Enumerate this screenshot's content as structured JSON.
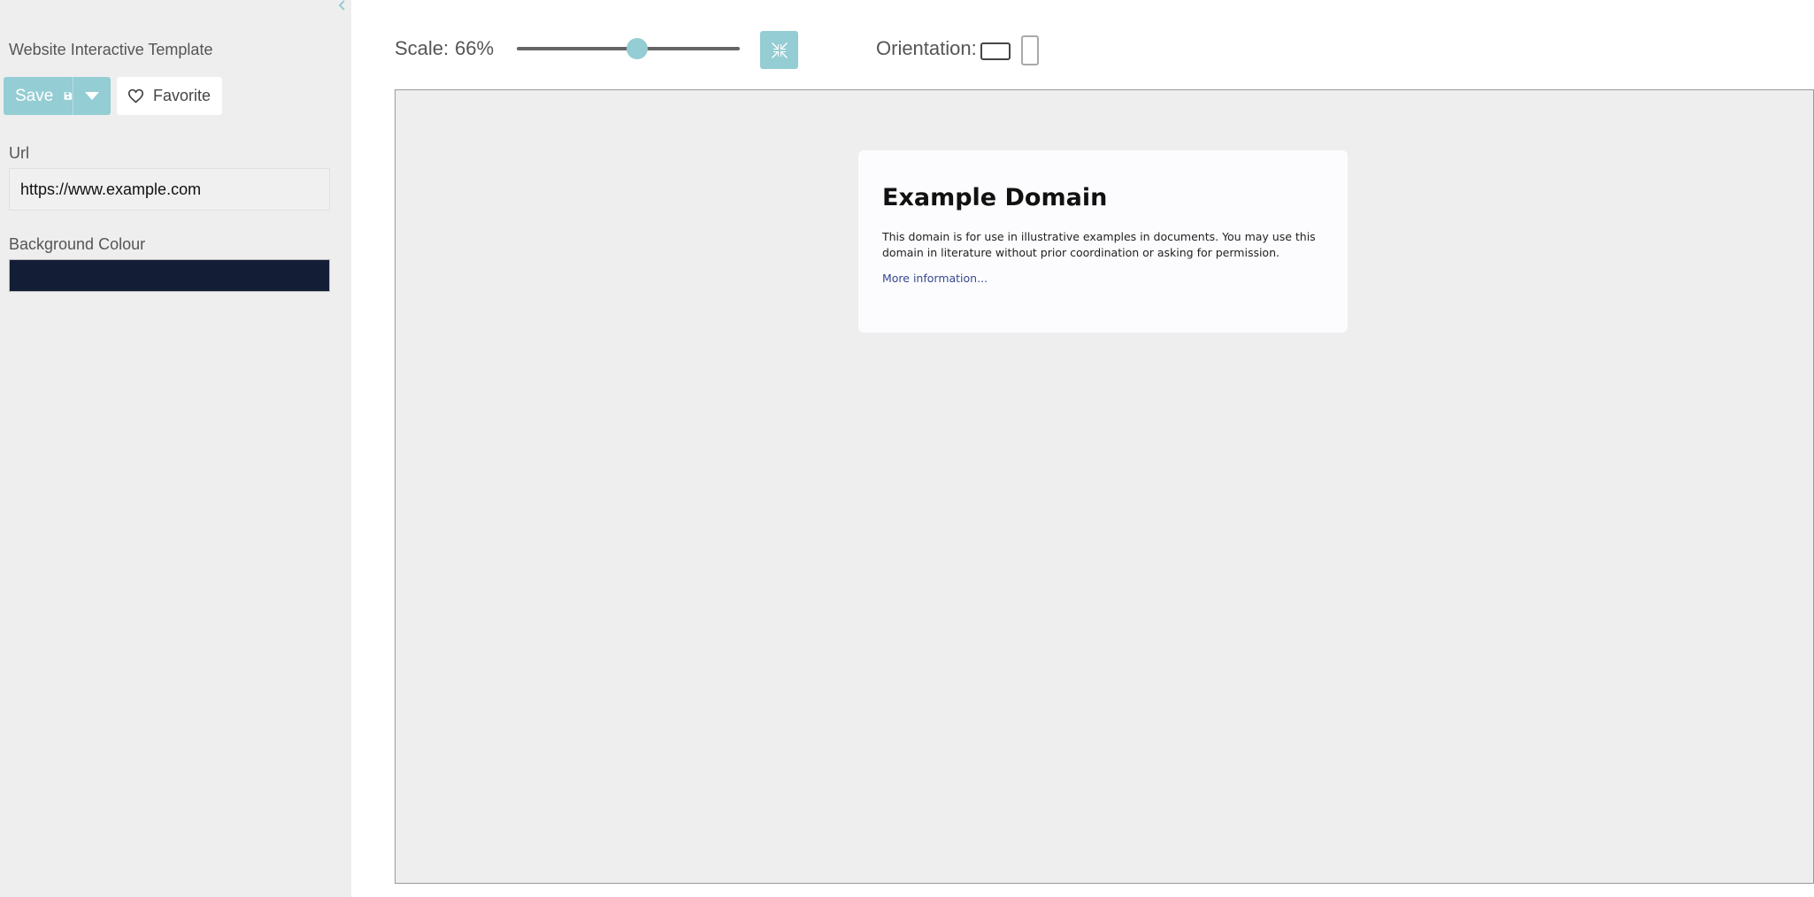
{
  "sidebar": {
    "template_title": "Website Interactive Template",
    "save_label": "Save",
    "favorite_label": "Favorite",
    "url_label": "Url",
    "url_value": "https://www.example.com",
    "background_label": "Background Colour",
    "background_value": "#141d36"
  },
  "toolbar": {
    "scale_label": "Scale:",
    "scale_value": "66%",
    "scale_level": 0.54,
    "orientation_label": "Orientation:",
    "selected_orientation": "landscape"
  },
  "preview": {
    "heading": "Example Domain",
    "paragraph": "This domain is for use in illustrative examples in documents. You may use this domain in literature without prior coordination or asking for permission.",
    "link_text": "More information..."
  },
  "colors": {
    "accent": "#94cdd3",
    "sidebar_bg": "#eeeeee",
    "preview_bg": "#eeeeef",
    "link": "#38488f"
  },
  "icons": {
    "collapse": "chevron-left-icon",
    "save": "floppy-disk-icon",
    "save_menu": "caret-down-icon",
    "favorite": "heart-outline-icon",
    "fit": "compress-arrows-icon",
    "landscape": "landscape-icon",
    "portrait": "portrait-icon"
  }
}
